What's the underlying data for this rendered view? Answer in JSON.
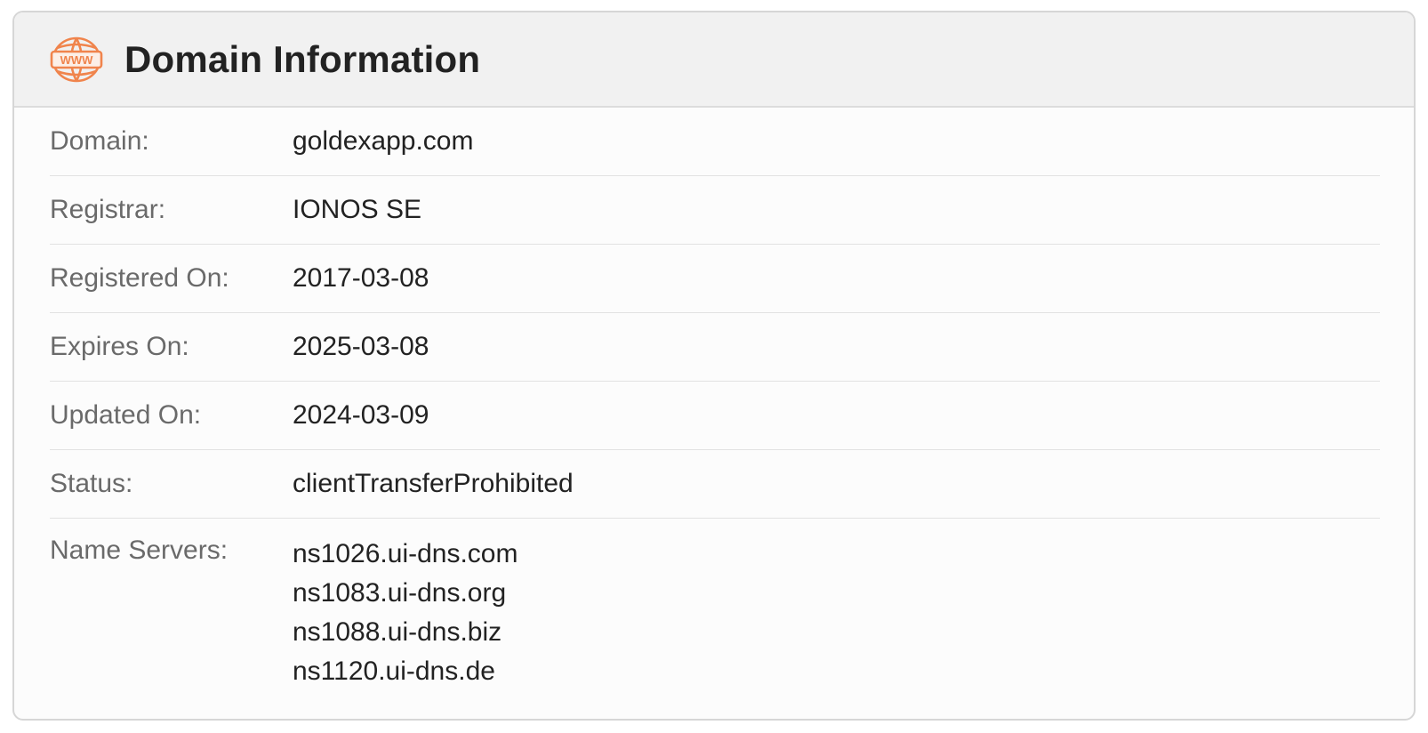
{
  "header": {
    "title": "Domain Information",
    "icon": "www-globe-icon",
    "icon_text": "WWW",
    "icon_color": "#f0844c"
  },
  "rows": [
    {
      "label": "Domain:",
      "value": "goldexapp.com"
    },
    {
      "label": "Registrar:",
      "value": "IONOS SE"
    },
    {
      "label": "Registered On:",
      "value": "2017-03-08"
    },
    {
      "label": "Expires On:",
      "value": "2025-03-08"
    },
    {
      "label": "Updated On:",
      "value": "2024-03-09"
    },
    {
      "label": "Status:",
      "value": "clientTransferProhibited"
    }
  ],
  "name_servers": {
    "label": "Name Servers:",
    "values": [
      "ns1026.ui-dns.com",
      "ns1083.ui-dns.org",
      "ns1088.ui-dns.biz",
      "ns1120.ui-dns.de"
    ]
  }
}
